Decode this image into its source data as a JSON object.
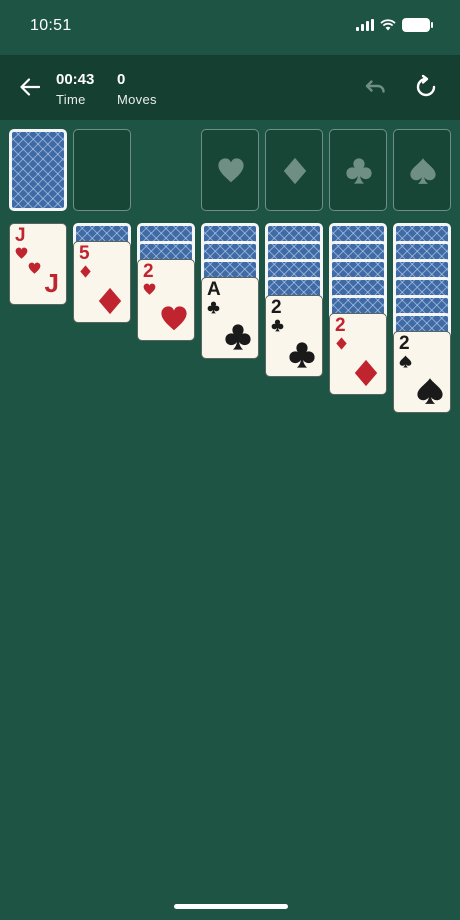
{
  "status_bar": {
    "time": "10:51"
  },
  "header": {
    "time_value": "00:43",
    "time_label": "Time",
    "moves_value": "0",
    "moves_label": "Moves"
  },
  "foundations": [
    "heart",
    "diamond",
    "club",
    "spade"
  ],
  "tableau": [
    {
      "face_down": 0,
      "face_up": {
        "rank": "J",
        "suit": "heart",
        "color": "red"
      }
    },
    {
      "face_down": 1,
      "face_up": {
        "rank": "5",
        "suit": "diamond",
        "color": "red"
      }
    },
    {
      "face_down": 2,
      "face_up": {
        "rank": "2",
        "suit": "heart",
        "color": "red"
      }
    },
    {
      "face_down": 3,
      "face_up": {
        "rank": "A",
        "suit": "club",
        "color": "black"
      }
    },
    {
      "face_down": 4,
      "face_up": {
        "rank": "2",
        "suit": "club",
        "color": "black"
      }
    },
    {
      "face_down": 5,
      "face_up": {
        "rank": "2",
        "suit": "diamond",
        "color": "red"
      }
    },
    {
      "face_down": 6,
      "face_up": {
        "rank": "2",
        "suit": "spade",
        "color": "black"
      }
    }
  ],
  "colors": {
    "table": "#1d5444",
    "header": "#153f31",
    "red_suit": "#c0242f",
    "black_suit": "#1a1a1a",
    "card_back": "#3e6aa6"
  }
}
